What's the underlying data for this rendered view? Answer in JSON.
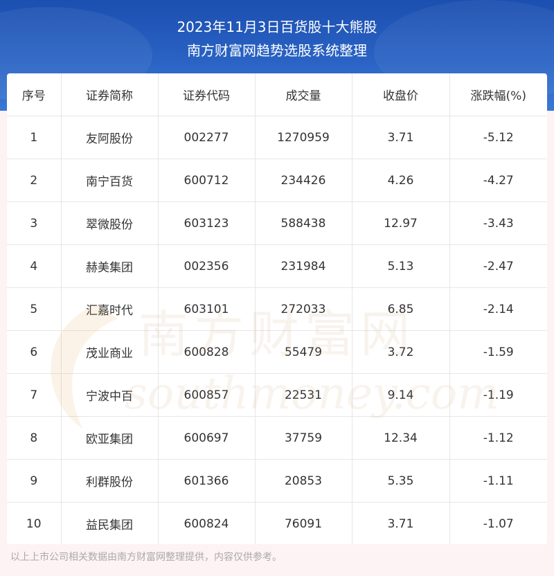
{
  "header": {
    "title": "2023年11月3日百货股十大熊股",
    "subtitle": "南方财富网趋势选股系统整理"
  },
  "table": {
    "columns": [
      "序号",
      "证券简称",
      "证券代码",
      "成交量",
      "收盘价",
      "涨跌幅(%)"
    ],
    "rows": [
      [
        "1",
        "友阿股份",
        "002277",
        "1270959",
        "3.71",
        "-5.12"
      ],
      [
        "2",
        "南宁百货",
        "600712",
        "234426",
        "4.26",
        "-4.27"
      ],
      [
        "3",
        "翠微股份",
        "603123",
        "588438",
        "12.97",
        "-3.43"
      ],
      [
        "4",
        "赫美集团",
        "002356",
        "231984",
        "5.13",
        "-2.47"
      ],
      [
        "5",
        "汇嘉时代",
        "603101",
        "272033",
        "6.85",
        "-2.14"
      ],
      [
        "6",
        "茂业商业",
        "600828",
        "55479",
        "3.72",
        "-1.59"
      ],
      [
        "7",
        "宁波中百",
        "600857",
        "22531",
        "9.14",
        "-1.19"
      ],
      [
        "8",
        "欧亚集团",
        "600697",
        "37759",
        "12.34",
        "-1.12"
      ],
      [
        "9",
        "利群股份",
        "601366",
        "20853",
        "5.35",
        "-1.11"
      ],
      [
        "10",
        "益民集团",
        "600824",
        "76091",
        "3.71",
        "-1.07"
      ]
    ]
  },
  "watermark": {
    "cn": "南方财富网",
    "en": "southmoney.com"
  },
  "footer": {
    "note": "以上上市公司相关数据由南方财富网整理提供，内容仅供参考。"
  }
}
